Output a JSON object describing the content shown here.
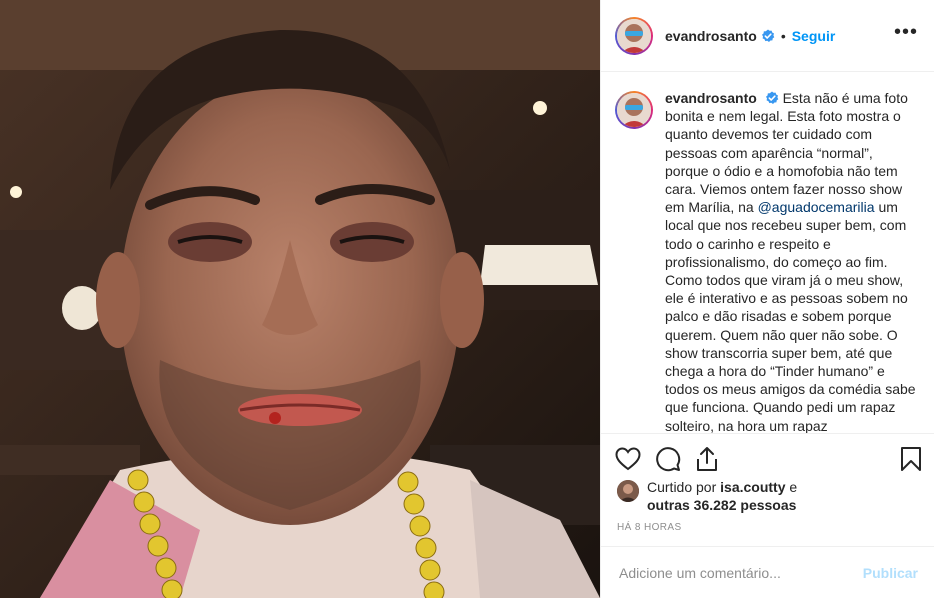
{
  "post": {
    "photo_icon": "selfie-photo",
    "author": {
      "username": "evandrosanto",
      "verified_icon": "verified-badge-icon",
      "separator": "•",
      "follow_label": "Seguir",
      "more_label": "•••"
    },
    "caption": {
      "username": "evandrosanto",
      "text_before_mention": "Esta não é uma foto bonita e nem legal. Esta foto mostra o quanto devemos ter cuidado com pessoas com aparência “normal”, porque o ódio e a homofobia não tem cara. Viemos ontem fazer nosso show em Marília, na",
      "mention": "@aguadocemarilia",
      "text_after_mention": "um local que nos recebeu super bem, com todo o carinho e respeito e profissionalismo, do começo ao fim. Como todos que viram já o meu show, ele é interativo e as pessoas sobem no palco e dão risadas e sobem porque querem. Quem não quer não sobe. O show transcorria super bem, até que chega a hora do “Tinder humano” e todos os meus amigos da comédia sabe que funciona. Quando pedi um rapaz solteiro, na hora um rapaz"
    },
    "actions": {
      "like_icon": "heart-icon",
      "comment_icon": "comment-icon",
      "share_icon": "share-icon",
      "save_icon": "bookmark-icon"
    },
    "likes": {
      "prefix": "Curtido por",
      "first_liker": "isa.coutty",
      "connector": "e",
      "others": "outras 36.282 pessoas"
    },
    "timestamp": "HÁ 8 HORAS",
    "comment": {
      "placeholder": "Adicione um comentário...",
      "value": "",
      "publish_label": "Publicar"
    }
  },
  "colors": {
    "link_blue": "#0095f6",
    "mention": "#00376b",
    "publish_disabled": "#b2dffc",
    "muted": "#8e8e8e",
    "verified": "#3897f0"
  }
}
